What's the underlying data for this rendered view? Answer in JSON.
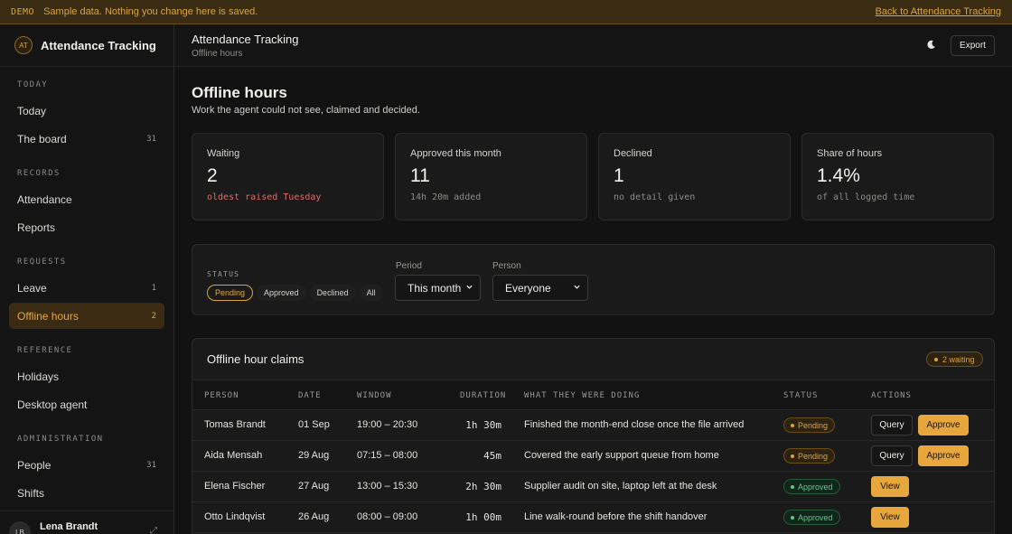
{
  "banner": {
    "tag": "DEMO",
    "message": "Sample data. Nothing you change here is saved.",
    "back_link": "Back to Attendance Tracking"
  },
  "brand": {
    "initials": "AT",
    "name": "Attendance Tracking"
  },
  "sidebar": {
    "sections": [
      {
        "title": "TODAY",
        "items": [
          {
            "label": "Today",
            "count": ""
          },
          {
            "label": "The board",
            "count": "31"
          }
        ]
      },
      {
        "title": "RECORDS",
        "items": [
          {
            "label": "Attendance",
            "count": ""
          },
          {
            "label": "Reports",
            "count": ""
          }
        ]
      },
      {
        "title": "REQUESTS",
        "items": [
          {
            "label": "Leave",
            "count": "1"
          },
          {
            "label": "Offline hours",
            "count": "2"
          }
        ]
      },
      {
        "title": "REFERENCE",
        "items": [
          {
            "label": "Holidays",
            "count": ""
          },
          {
            "label": "Desktop agent",
            "count": ""
          }
        ]
      },
      {
        "title": "ADMINISTRATION",
        "items": [
          {
            "label": "People",
            "count": "31"
          },
          {
            "label": "Shifts",
            "count": ""
          }
        ]
      }
    ],
    "active": "Offline hours"
  },
  "user": {
    "initials": "LB",
    "name": "Lena Brandt"
  },
  "topbar": {
    "title": "Attendance Tracking",
    "subtitle": "Offline hours",
    "export_label": "Export",
    "theme_icon": "moon-icon"
  },
  "page": {
    "title": "Offline hours",
    "description": "Work the agent could not see, claimed and decided."
  },
  "stats": [
    {
      "label": "Waiting",
      "value": "2",
      "note": "oldest raised Tuesday"
    },
    {
      "label": "Approved this month",
      "value": "11",
      "note": "14h 20m added"
    },
    {
      "label": "Declined",
      "value": "1",
      "note": "no detail given"
    },
    {
      "label": "Share of hours",
      "value": "1.4%",
      "note": "of all logged time"
    }
  ],
  "filters": {
    "status_label": "STATUS",
    "status_options": [
      "Pending",
      "Approved",
      "Declined",
      "All"
    ],
    "status_selected": "Pending",
    "period_label": "Period",
    "period_value": "This month",
    "person_label": "Person",
    "person_value": "Everyone"
  },
  "claims": {
    "title": "Offline hour claims",
    "waiting_badge": "2 waiting",
    "columns": [
      "PERSON",
      "DATE",
      "WINDOW",
      "DURATION",
      "WHAT THEY WERE DOING",
      "STATUS",
      "ACTIONS"
    ],
    "rows": [
      {
        "person": "Tomas Brandt",
        "date": "01 Sep",
        "window": "19:00 – 20:30",
        "duration": "1h 30m",
        "activity": "Finished the month-end close once the file arrived",
        "status": "Pending",
        "actions": [
          "Query",
          "Approve"
        ]
      },
      {
        "person": "Aida Mensah",
        "date": "29 Aug",
        "window": "07:15 – 08:00",
        "duration": "45m",
        "activity": "Covered the early support queue from home",
        "status": "Pending",
        "actions": [
          "Query",
          "Approve"
        ]
      },
      {
        "person": "Elena Fischer",
        "date": "27 Aug",
        "window": "13:00 – 15:30",
        "duration": "2h 30m",
        "activity": "Supplier audit on site, laptop left at the desk",
        "status": "Approved",
        "actions": [
          "View"
        ]
      },
      {
        "person": "Otto Lindqvist",
        "date": "26 Aug",
        "window": "08:00 – 09:00",
        "duration": "1h 00m",
        "activity": "Line walk-round before the shift handover",
        "status": "Approved",
        "actions": [
          "View"
        ]
      }
    ]
  },
  "colors": {
    "accent": "#e8a73d",
    "background": "#121212",
    "danger": "#e06b6b",
    "success": "#5ec98a"
  }
}
